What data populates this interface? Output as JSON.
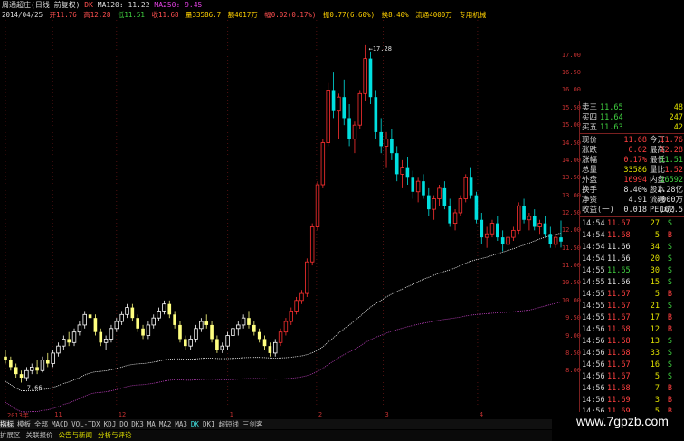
{
  "title": {
    "name": "周通超庄(日线 前复权)",
    "dk": "DK",
    "ma120_label": "MA120: 11.22",
    "ma250_label": "MA250: 9.45"
  },
  "info": {
    "date": "2014/04/25",
    "open": "开11.76",
    "high": "高12.28",
    "low": "低11.51",
    "close": "收11.68",
    "amount": "量33586.7",
    "quantity": "额4017万",
    "change": "幅0.02(0.17%)",
    "amp": "振0.77(6.60%)",
    "turnover": "换8.40%",
    "float": "流通4000万",
    "org": "专用机械"
  },
  "chart_data": {
    "type": "candlestick",
    "annotations": [
      "17.28",
      "7.66"
    ],
    "ylim": [
      7.0,
      18.0
    ],
    "y_ticks": [
      "17.00",
      "16.50",
      "16.00",
      "15.50",
      "15.00",
      "14.50",
      "14.00",
      "13.50",
      "13.00",
      "12.50",
      "12.00",
      "11.50",
      "11.00",
      "10.50",
      "10.00",
      "9.50",
      "9.00",
      "8.50",
      "8.00"
    ],
    "x_labels": [
      "2013年",
      "11",
      "12",
      "1",
      "2",
      "3",
      "4"
    ],
    "candles": [
      [
        8.4,
        8.6,
        8.2,
        8.3
      ],
      [
        8.3,
        8.4,
        8.0,
        8.1
      ],
      [
        8.1,
        8.2,
        7.8,
        7.9
      ],
      [
        7.9,
        8.0,
        7.66,
        7.8
      ],
      [
        7.8,
        8.1,
        7.7,
        8.0
      ],
      [
        8.0,
        8.2,
        7.9,
        8.1
      ],
      [
        8.1,
        8.3,
        7.9,
        8.0
      ],
      [
        8.0,
        8.4,
        7.95,
        8.3
      ],
      [
        8.3,
        8.5,
        8.1,
        8.2
      ],
      [
        8.2,
        8.6,
        8.1,
        8.5
      ],
      [
        8.5,
        8.8,
        8.4,
        8.7
      ],
      [
        8.7,
        9.0,
        8.6,
        8.9
      ],
      [
        8.9,
        9.1,
        8.7,
        8.8
      ],
      [
        8.8,
        9.2,
        8.7,
        9.1
      ],
      [
        9.1,
        9.4,
        9.0,
        9.3
      ],
      [
        9.3,
        9.7,
        9.2,
        9.6
      ],
      [
        9.6,
        9.9,
        9.4,
        9.5
      ],
      [
        9.5,
        9.6,
        9.0,
        9.1
      ],
      [
        9.1,
        9.2,
        8.7,
        8.8
      ],
      [
        8.8,
        9.0,
        8.6,
        8.9
      ],
      [
        8.9,
        9.3,
        8.8,
        9.2
      ],
      [
        9.2,
        9.5,
        9.1,
        9.4
      ],
      [
        9.4,
        9.7,
        9.3,
        9.6
      ],
      [
        9.6,
        9.9,
        9.5,
        9.8
      ],
      [
        9.8,
        9.9,
        9.4,
        9.5
      ],
      [
        9.5,
        9.6,
        9.1,
        9.2
      ],
      [
        9.2,
        9.3,
        8.9,
        9.0
      ],
      [
        9.0,
        9.4,
        8.9,
        9.3
      ],
      [
        9.3,
        9.6,
        9.2,
        9.5
      ],
      [
        9.5,
        9.8,
        9.4,
        9.7
      ],
      [
        9.7,
        10.0,
        9.6,
        9.9
      ],
      [
        9.9,
        10.0,
        9.5,
        9.6
      ],
      [
        9.6,
        9.7,
        9.2,
        9.3
      ],
      [
        9.3,
        9.4,
        8.8,
        8.9
      ],
      [
        8.9,
        9.0,
        8.6,
        8.7
      ],
      [
        8.7,
        9.0,
        8.6,
        8.9
      ],
      [
        8.9,
        9.3,
        8.8,
        9.2
      ],
      [
        9.2,
        9.5,
        9.1,
        9.4
      ],
      [
        9.4,
        9.6,
        9.2,
        9.3
      ],
      [
        9.3,
        9.4,
        8.8,
        8.9
      ],
      [
        8.9,
        9.0,
        8.5,
        8.6
      ],
      [
        8.6,
        8.8,
        8.5,
        8.7
      ],
      [
        8.7,
        9.1,
        8.6,
        9.0
      ],
      [
        9.0,
        9.3,
        8.9,
        9.2
      ],
      [
        9.2,
        9.4,
        9.0,
        9.3
      ],
      [
        9.3,
        9.6,
        9.2,
        9.5
      ],
      [
        9.5,
        9.7,
        9.2,
        9.3
      ],
      [
        9.3,
        9.4,
        9.0,
        9.1
      ],
      [
        9.1,
        9.2,
        8.8,
        8.9
      ],
      [
        8.9,
        9.0,
        8.6,
        8.7
      ],
      [
        8.7,
        8.8,
        8.4,
        8.5
      ],
      [
        8.5,
        8.9,
        8.4,
        8.8
      ],
      [
        8.8,
        9.2,
        8.7,
        9.1
      ],
      [
        9.1,
        9.5,
        9.0,
        9.4
      ],
      [
        9.4,
        9.8,
        9.3,
        9.7
      ],
      [
        9.7,
        10.1,
        9.6,
        10.0
      ],
      [
        10.0,
        10.3,
        9.9,
        10.2
      ],
      [
        10.2,
        11.2,
        10.1,
        11.1
      ],
      [
        11.1,
        12.2,
        11.0,
        12.1
      ],
      [
        12.1,
        13.4,
        12.0,
        13.3
      ],
      [
        13.3,
        14.6,
        13.2,
        14.5
      ],
      [
        14.5,
        16.2,
        14.4,
        16.0
      ],
      [
        16.0,
        16.5,
        15.2,
        15.4
      ],
      [
        15.4,
        15.9,
        14.6,
        15.8
      ],
      [
        15.8,
        16.3,
        15.0,
        15.2
      ],
      [
        15.2,
        15.6,
        14.4,
        14.6
      ],
      [
        14.6,
        15.1,
        14.2,
        15.0
      ],
      [
        15.0,
        16.0,
        14.9,
        15.9
      ],
      [
        15.9,
        17.28,
        15.7,
        16.9
      ],
      [
        16.9,
        17.1,
        15.6,
        15.8
      ],
      [
        15.8,
        16.0,
        14.6,
        14.8
      ],
      [
        14.8,
        15.2,
        14.2,
        14.4
      ],
      [
        14.4,
        14.8,
        13.8,
        14.6
      ],
      [
        14.6,
        14.9,
        14.0,
        14.2
      ],
      [
        14.2,
        14.4,
        13.4,
        13.6
      ],
      [
        13.6,
        14.0,
        13.2,
        13.8
      ],
      [
        13.8,
        14.1,
        13.3,
        13.5
      ],
      [
        13.5,
        13.7,
        12.9,
        13.1
      ],
      [
        13.1,
        13.5,
        12.8,
        13.4
      ],
      [
        13.4,
        13.6,
        12.9,
        13.0
      ],
      [
        13.0,
        13.2,
        12.4,
        12.6
      ],
      [
        12.6,
        13.0,
        12.3,
        12.9
      ],
      [
        12.9,
        13.3,
        12.7,
        13.2
      ],
      [
        13.2,
        13.4,
        12.6,
        12.7
      ],
      [
        12.7,
        12.9,
        12.1,
        12.2
      ],
      [
        12.2,
        12.6,
        12.0,
        12.5
      ],
      [
        12.5,
        13.0,
        12.4,
        12.9
      ],
      [
        12.9,
        13.6,
        12.8,
        13.5
      ],
      [
        13.5,
        13.8,
        12.9,
        13.0
      ],
      [
        13.0,
        13.1,
        12.2,
        12.3
      ],
      [
        12.3,
        12.5,
        11.6,
        11.8
      ],
      [
        11.8,
        12.1,
        11.5,
        11.9
      ],
      [
        11.9,
        12.3,
        11.8,
        12.2
      ],
      [
        12.2,
        12.4,
        11.7,
        11.8
      ],
      [
        11.8,
        12.0,
        11.4,
        11.6
      ],
      [
        11.6,
        11.9,
        11.4,
        11.8
      ],
      [
        11.8,
        12.1,
        11.7,
        12.0
      ],
      [
        12.0,
        12.8,
        11.9,
        12.7
      ],
      [
        12.7,
        12.9,
        12.2,
        12.3
      ],
      [
        12.3,
        12.5,
        12.0,
        12.4
      ],
      [
        12.4,
        12.6,
        12.0,
        12.1
      ],
      [
        12.1,
        12.3,
        11.9,
        12.2
      ],
      [
        12.2,
        12.4,
        11.8,
        11.9
      ],
      [
        11.9,
        12.1,
        11.5,
        11.6
      ],
      [
        11.6,
        11.9,
        11.5,
        11.8
      ],
      [
        11.8,
        12.28,
        11.51,
        11.68
      ]
    ]
  },
  "quote": {
    "asks": [
      {
        "label": "卖三",
        "price": "11.65",
        "vol": "48"
      },
      {
        "label": "买四",
        "price": "11.64",
        "vol": "247"
      },
      {
        "label": "买五",
        "price": "11.63",
        "vol": "42"
      }
    ],
    "stats": [
      {
        "l1": "现价",
        "v1": "11.68",
        "c1": "red",
        "l2": "今开",
        "v2": "11.76",
        "c2": "red"
      },
      {
        "l1": "涨跌",
        "v1": "0.02",
        "c1": "red",
        "l2": "最高",
        "v2": "12.28",
        "c2": "red"
      },
      {
        "l1": "涨幅",
        "v1": "0.17%",
        "c1": "red",
        "l2": "最低",
        "v2": "11.51",
        "c2": "green"
      },
      {
        "l1": "总量",
        "v1": "33586",
        "c1": "yellow",
        "l2": "量比",
        "v2": "1.52",
        "c2": "red"
      },
      {
        "l1": "外盘",
        "v1": "16994",
        "c1": "red",
        "l2": "内盘",
        "v2": "16592",
        "c2": "green"
      },
      {
        "l1": "换手",
        "v1": "8.40%",
        "c1": "white",
        "l2": "股本",
        "v2": "1.28亿",
        "c2": "white"
      },
      {
        "l1": "净资",
        "v1": "4.91",
        "c1": "white",
        "l2": "流通",
        "v2": "4000万",
        "c2": "white"
      },
      {
        "l1": "收益(一)",
        "v1": "0.018",
        "c1": "white",
        "l2": "PE(动)",
        "v2": "162.5",
        "c2": "white"
      }
    ],
    "ticks": [
      {
        "t": "14:54",
        "p": "11.67",
        "pc": "red",
        "v": "27",
        "f": "S",
        "fc": "green"
      },
      {
        "t": "14:54",
        "p": "11.68",
        "pc": "red",
        "v": "5",
        "f": "B",
        "fc": "red"
      },
      {
        "t": "14:54",
        "p": "11.66",
        "pc": "white",
        "v": "34",
        "f": "S",
        "fc": "green"
      },
      {
        "t": "14:54",
        "p": "11.66",
        "pc": "white",
        "v": "20",
        "f": "S",
        "fc": "green"
      },
      {
        "t": "14:55",
        "p": "11.65",
        "pc": "green",
        "v": "30",
        "f": "S",
        "fc": "green"
      },
      {
        "t": "14:55",
        "p": "11.66",
        "pc": "white",
        "v": "15",
        "f": "S",
        "fc": "green"
      },
      {
        "t": "14:55",
        "p": "11.67",
        "pc": "red",
        "v": "5",
        "f": "B",
        "fc": "red"
      },
      {
        "t": "14:55",
        "p": "11.67",
        "pc": "red",
        "v": "21",
        "f": "S",
        "fc": "green"
      },
      {
        "t": "14:55",
        "p": "11.67",
        "pc": "red",
        "v": "17",
        "f": "B",
        "fc": "red"
      },
      {
        "t": "14:56",
        "p": "11.68",
        "pc": "red",
        "v": "12",
        "f": "B",
        "fc": "red"
      },
      {
        "t": "14:56",
        "p": "11.68",
        "pc": "red",
        "v": "13",
        "f": "S",
        "fc": "green"
      },
      {
        "t": "14:56",
        "p": "11.68",
        "pc": "red",
        "v": "33",
        "f": "S",
        "fc": "green"
      },
      {
        "t": "14:56",
        "p": "11.67",
        "pc": "red",
        "v": "16",
        "f": "S",
        "fc": "green"
      },
      {
        "t": "14:56",
        "p": "11.67",
        "pc": "red",
        "v": "5",
        "f": "S",
        "fc": "green"
      },
      {
        "t": "14:56",
        "p": "11.68",
        "pc": "red",
        "v": "7",
        "f": "B",
        "fc": "red"
      },
      {
        "t": "14:56",
        "p": "11.69",
        "pc": "red",
        "v": "3",
        "f": "B",
        "fc": "red"
      },
      {
        "t": "14:56",
        "p": "11.69",
        "pc": "red",
        "v": "5",
        "f": "B",
        "fc": "red"
      }
    ]
  },
  "toolbar": {
    "tabs": [
      "指标",
      "模板",
      "全部",
      "MACD",
      "VOL-TDX",
      "KDJ",
      "DQ",
      "DK3",
      "MA",
      "MA2",
      "MA3",
      "DK",
      "DK1",
      "超短线",
      "三剑客"
    ],
    "links": [
      "扩展区",
      "关联报价",
      "公告与新闻",
      "分析与评论"
    ]
  },
  "watermark": "www.7gpzb.com",
  "colors": {
    "up": "#ff3030",
    "down": "#00e0e0",
    "ma120": "#ffffff",
    "ma250": "#c040c0",
    "doji_yellow": "#ffff80"
  }
}
